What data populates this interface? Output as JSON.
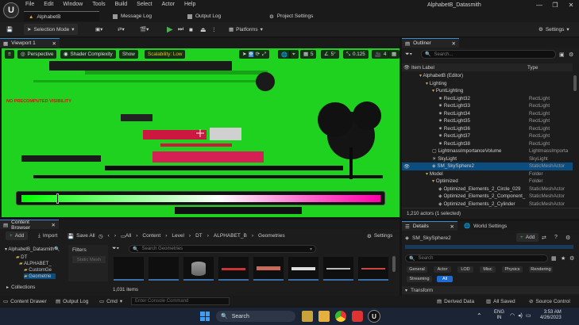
{
  "app": {
    "window_title": "AlphabetB_Datasmith",
    "menus": [
      "File",
      "Edit",
      "Window",
      "Tools",
      "Build",
      "Select",
      "Actor",
      "Help"
    ],
    "tabs": [
      {
        "label": "AlphabetB",
        "active": true
      },
      {
        "label": "Message Log",
        "active": false
      },
      {
        "label": "Output Log",
        "active": false
      },
      {
        "label": "Project Settings",
        "active": false
      }
    ]
  },
  "toolbar": {
    "selection_mode": "Selection Mode",
    "platforms": "Platforms",
    "settings": "Settings"
  },
  "viewport": {
    "tab_label": "Viewport 1",
    "perspective": "Perspective",
    "view_mode": "Shader Complexity",
    "show": "Show",
    "scalability": "Scalability: Low",
    "grid_value": "5",
    "angle_value": "5°",
    "scale_value": "0.125",
    "camera_speed": "4",
    "overlay_message": "NO PRECOMPUTED VISIBILITY"
  },
  "outliner": {
    "tab_label": "Outliner",
    "search_placeholder": "Search...",
    "col_label": "Item Label",
    "col_type": "Type",
    "rows": [
      {
        "label": "AlphabetB (Editor)",
        "type": "",
        "indent": 0
      },
      {
        "label": "Lighting",
        "type": "",
        "indent": 1
      },
      {
        "label": "PuntLighting",
        "type": "",
        "indent": 2
      },
      {
        "label": "RectLight32",
        "type": "RectLight",
        "indent": 3
      },
      {
        "label": "RectLight33",
        "type": "RectLight",
        "indent": 3
      },
      {
        "label": "RectLight34",
        "type": "RectLight",
        "indent": 3
      },
      {
        "label": "RectLight35",
        "type": "RectLight",
        "indent": 3
      },
      {
        "label": "RectLight36",
        "type": "RectLight",
        "indent": 3
      },
      {
        "label": "RectLight37",
        "type": "RectLight",
        "indent": 3
      },
      {
        "label": "RectLight38",
        "type": "RectLight",
        "indent": 3
      },
      {
        "label": "LightmassImportanceVolume",
        "type": "LightmassImporta",
        "indent": 2
      },
      {
        "label": "SkyLight",
        "type": "SkyLight",
        "indent": 2
      },
      {
        "label": "SM_SkySphere2",
        "type": "StaticMeshActor",
        "indent": 2,
        "selected": true
      },
      {
        "label": "Model",
        "type": "Folder",
        "indent": 1
      },
      {
        "label": "Optimized",
        "type": "Folder",
        "indent": 2
      },
      {
        "label": "Optimized_Elements_2_Circle_029",
        "type": "StaticMeshActor",
        "indent": 3
      },
      {
        "label": "Optimized_Elements_2_Component_",
        "type": "StaticMeshActor",
        "indent": 3
      },
      {
        "label": "Optimized_Elements_2_Cylinder",
        "type": "StaticMeshActor",
        "indent": 3
      }
    ],
    "footer": "1,210 actors (1 selected)"
  },
  "content_browser": {
    "tab_label": "Content Browser",
    "add": "Add",
    "import": "Import",
    "save_all": "Save All",
    "breadcrumb": [
      "All",
      "Content",
      "Level",
      "DT",
      "ALPHABET_B",
      "Geometries"
    ],
    "settings": "Settings",
    "tree_root": "AlphabetB_Datasmith",
    "tree_items": [
      "DT",
      "ALPHABET_",
      "CustomGe",
      "Geometrie"
    ],
    "filters_label": "Filters",
    "filter_chip": "Static Mesh",
    "search_placeholder": "Search Geometries",
    "item_count": "1,031 items",
    "collections": "Collections"
  },
  "details": {
    "tab_label": "Details",
    "world_settings": "World Settings",
    "selected_name": "SM_SkySphere2",
    "add": "Add",
    "search_placeholder": "Search",
    "chips_row1": [
      "General",
      "Actor",
      "LOD",
      "Misc",
      "Physics",
      "Rendering"
    ],
    "chips_row2": [
      "Streaming",
      "All"
    ],
    "section": "Transform"
  },
  "statusbar": {
    "content_drawer": "Content Drawer",
    "output_log": "Output Log",
    "cmd": "Cmd",
    "console_placeholder": "Enter Console Command",
    "derived_data": "Derived Data",
    "all_saved": "All Saved",
    "source_control": "Source Control"
  },
  "taskbar": {
    "search": "Search",
    "lang": "ENG",
    "region": "IN",
    "time": "3:53 AM",
    "date": "4/26/2023"
  },
  "colors": {
    "accent_blue": "#0c4d80",
    "viewport_green": "#1fd21f",
    "play_green": "#4caf50"
  }
}
